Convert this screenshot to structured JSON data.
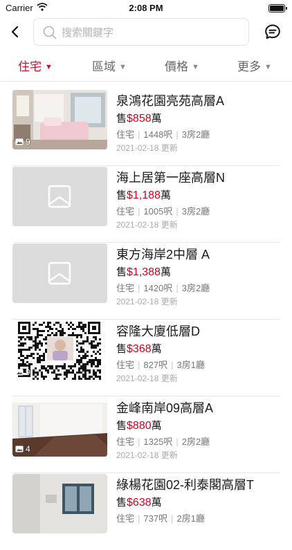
{
  "status_bar": {
    "carrier": "Carrier",
    "time": "2:08 PM"
  },
  "search": {
    "placeholder": "搜索關鍵字"
  },
  "filters": [
    {
      "label": "住宅",
      "active": true
    },
    {
      "label": "區域",
      "active": false
    },
    {
      "label": "價格",
      "active": false
    },
    {
      "label": "更多",
      "active": false
    }
  ],
  "listings": [
    {
      "title": "泉鴻花園亮苑高層A",
      "price_prefix": "售",
      "price": "$858",
      "price_suffix": "萬",
      "type": "住宅",
      "area": "1448呎",
      "rooms": "3房2廳",
      "date": "2021-02-18 更新",
      "photo_count": "9",
      "image": "bedroom"
    },
    {
      "title": "海上居第一座高層N",
      "price_prefix": "售",
      "price": "$1,188",
      "price_suffix": "萬",
      "type": "住宅",
      "area": "1005呎",
      "rooms": "3房2廳",
      "date": "2021-02-18 更新",
      "photo_count": "",
      "image": "placeholder"
    },
    {
      "title": "東方海岸2中層 A",
      "price_prefix": "售",
      "price": "$1,388",
      "price_suffix": "萬",
      "type": "住宅",
      "area": "1420呎",
      "rooms": "3房2廳",
      "date": "2021-02-18 更新",
      "photo_count": "",
      "image": "placeholder"
    },
    {
      "title": "容隆大廈低層D",
      "price_prefix": "售",
      "price": "$368",
      "price_suffix": "萬",
      "type": "住宅",
      "area": "827呎",
      "rooms": "3房1廳",
      "date": "2021-02-18 更新",
      "photo_count": "9",
      "image": "qr"
    },
    {
      "title": "金峰南岸09高層A",
      "price_prefix": "售",
      "price": "$880",
      "price_suffix": "萬",
      "type": "住宅",
      "area": "1325呎",
      "rooms": "2房2廳",
      "date": "2021-02-18 更新",
      "photo_count": "4",
      "image": "room"
    },
    {
      "title": "綠楊花園02-利泰閣高層T",
      "price_prefix": "售",
      "price": "$638",
      "price_suffix": "萬",
      "type": "住宅",
      "area": "737呎",
      "rooms": "2房1廳",
      "date": "",
      "photo_count": "",
      "image": "window"
    }
  ],
  "colors": {
    "accent": "#c8102e",
    "price": "#d0021b"
  },
  "icons": {
    "back": "chevron-left-icon",
    "search": "search-icon",
    "chat": "chat-bubble-icon",
    "photo": "photo-icon"
  }
}
